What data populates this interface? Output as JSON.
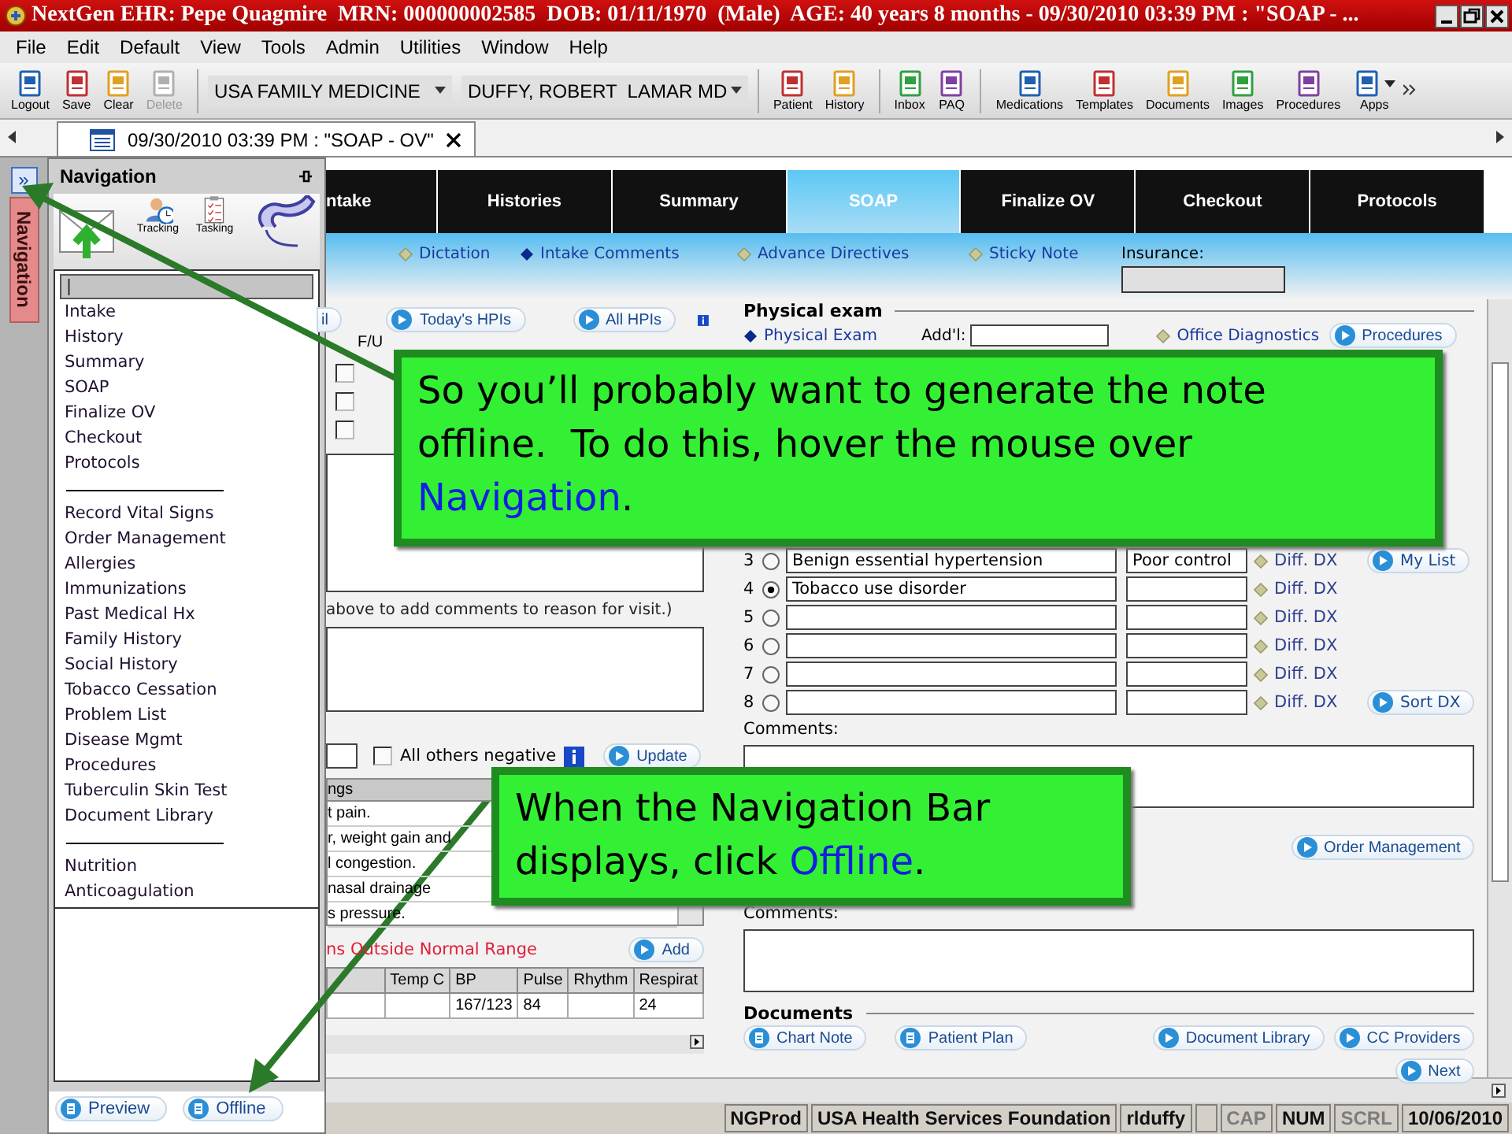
{
  "title_bar": {
    "title": "NextGen EHR: Pepe Quagmire  MRN: 000000002585  DOB: 01/11/1970  (Male)  AGE: 40 years 8 months - 09/30/2010 03:39 PM : \"SOAP - ..."
  },
  "menu": [
    "File",
    "Edit",
    "Default",
    "View",
    "Tools",
    "Admin",
    "Utilities",
    "Window",
    "Help"
  ],
  "toolbar": {
    "left": [
      {
        "label": "Logout",
        "disabled": false
      },
      {
        "label": "Save",
        "disabled": false
      },
      {
        "label": "Clear",
        "disabled": false
      },
      {
        "label": "Delete",
        "disabled": true
      }
    ],
    "combos": [
      "USA FAMILY MEDICINE",
      "DUFFY, ROBERT  LAMAR MD"
    ],
    "right": [
      {
        "label": "Patient",
        "dropdown": false
      },
      {
        "label": "History",
        "dropdown": false
      },
      {
        "label": "Inbox",
        "dropdown": false
      },
      {
        "label": "PAQ",
        "dropdown": false
      },
      {
        "label": "Medications",
        "dropdown": false
      },
      {
        "label": "Templates",
        "dropdown": false
      },
      {
        "label": "Documents",
        "dropdown": false
      },
      {
        "label": "Images",
        "dropdown": false
      },
      {
        "label": "Procedures",
        "dropdown": false
      },
      {
        "label": "Apps",
        "dropdown": true
      }
    ]
  },
  "document_tab": {
    "label": "09/30/2010 03:39 PM : \"SOAP - OV\"",
    "selected": true
  },
  "nav_strip": {
    "expand": "»",
    "label": "Navigation"
  },
  "nav_panel": {
    "title": "Navigation",
    "shortcuts": [
      {
        "kind": "mail"
      },
      {
        "kind": "tracking",
        "label": "Tracking"
      },
      {
        "kind": "tasking",
        "label": "Tasking"
      },
      {
        "kind": "phone"
      }
    ],
    "groups": [
      [
        {
          "label": "|",
          "selected": true
        },
        {
          "label": "Intake",
          "selected": false
        },
        {
          "label": "History",
          "selected": false
        },
        {
          "label": "Summary",
          "selected": false
        },
        {
          "label": "SOAP",
          "selected": false
        },
        {
          "label": "Finalize OV",
          "selected": false
        },
        {
          "label": "Checkout",
          "selected": false
        },
        {
          "label": "Protocols",
          "selected": false
        }
      ],
      [
        {
          "label": "Record Vital Signs",
          "selected": false
        },
        {
          "label": "Order Management",
          "selected": false
        },
        {
          "label": "Allergies",
          "selected": false
        },
        {
          "label": "Immunizations",
          "selected": false
        },
        {
          "label": "Past Medical Hx",
          "selected": false
        },
        {
          "label": "Family History",
          "selected": false
        },
        {
          "label": "Social History",
          "selected": false
        },
        {
          "label": "Tobacco Cessation",
          "selected": false
        },
        {
          "label": "Problem List",
          "selected": false
        },
        {
          "label": "Disease Mgmt",
          "selected": false
        },
        {
          "label": "Procedures",
          "selected": false
        },
        {
          "label": "Tuberculin Skin Test",
          "selected": false
        },
        {
          "label": "Document Library",
          "selected": false
        }
      ],
      [
        {
          "label": "Nutrition",
          "selected": false
        },
        {
          "label": "Anticoagulation",
          "selected": false
        }
      ]
    ],
    "buttons": [
      {
        "label": "Preview",
        "kind": "doc"
      },
      {
        "label": "Offline",
        "kind": "doc"
      }
    ]
  },
  "tabs": [
    {
      "label": "ntake",
      "selected": false
    },
    {
      "label": "Histories",
      "selected": false
    },
    {
      "label": "Summary",
      "selected": false
    },
    {
      "label": "SOAP",
      "selected": true
    },
    {
      "label": "Finalize OV",
      "selected": false
    },
    {
      "label": "Checkout",
      "selected": false
    },
    {
      "label": "Protocols",
      "selected": false
    }
  ],
  "links": [
    {
      "label": "Dictation",
      "filled": false
    },
    {
      "label": "Intake Comments",
      "filled": true
    },
    {
      "label": "Advance Directives",
      "filled": false
    },
    {
      "label": "Sticky Note",
      "filled": false
    }
  ],
  "insurance": {
    "label": "Insurance:"
  },
  "hpi": {
    "buttons": [
      {
        "label": "il",
        "kind": "none"
      },
      {
        "label": "Today's HPIs",
        "kind": "play"
      },
      {
        "label": "All HPIs",
        "kind": "play"
      }
    ],
    "fu_label": "F/U",
    "rows": [
      {
        "checked": false
      },
      {
        "checked": false
      },
      {
        "checked": false
      }
    ]
  },
  "reason_hint": "above to add comments to reason for visit.)",
  "ros": {
    "checkbox_label": "All others negative",
    "checked": false,
    "button": "Update",
    "header": "ngs",
    "rows": [
      "t pain.",
      "r, weight gain and",
      "l congestion.",
      "nasal drainage",
      "s pressure."
    ]
  },
  "vitals": {
    "title": "ns Outside Normal Range",
    "button": "Add",
    "columns": [
      "Temp C",
      "BP",
      "Pulse",
      "Rhythm",
      "Respirat"
    ],
    "rows": [
      [
        null,
        "167/123",
        "84",
        null,
        "24"
      ]
    ]
  },
  "physical_exam": {
    "title": "Physical exam",
    "link": {
      "label": "Physical Exam",
      "filled": true
    },
    "addl_label": "Add'l:",
    "diagnostics": {
      "label": "Office Diagnostics",
      "filled": false
    },
    "button": "Procedures"
  },
  "assessment": {
    "rows": [
      {
        "number": "3",
        "selected": false,
        "diagnosis": "Benign essential hypertension",
        "status": "Poor control",
        "link": "Diff. DX",
        "button": "My List"
      },
      {
        "number": "4",
        "selected": true,
        "diagnosis": "Tobacco use disorder",
        "link": "Diff. DX"
      },
      {
        "number": "5",
        "selected": false,
        "link": "Diff. DX"
      },
      {
        "number": "6",
        "selected": false,
        "link": "Diff. DX"
      },
      {
        "number": "7",
        "selected": false,
        "link": "Diff. DX"
      },
      {
        "number": "8",
        "selected": false,
        "link": "Diff. DX",
        "button": "Sort DX"
      }
    ],
    "comments_label": "Comments:"
  },
  "plan": {
    "button": "Order Management",
    "comments_label": "Comments:"
  },
  "documents": {
    "title": "Documents",
    "buttons": [
      {
        "label": "Chart Note",
        "kind": "doc"
      },
      {
        "label": "Patient Plan",
        "kind": "doc"
      },
      {
        "label": "Document Library",
        "kind": "play"
      },
      {
        "label": "CC Providers",
        "kind": "play"
      },
      {
        "label": "Next",
        "kind": "play"
      }
    ]
  },
  "status_bar": [
    {
      "label": "NGProd",
      "disabled": false
    },
    {
      "label": "USA Health Services Foundation",
      "disabled": false
    },
    {
      "label": "rlduffy",
      "disabled": false
    },
    {
      "label": "CAP",
      "disabled": true
    },
    {
      "label": "NUM",
      "disabled": false
    },
    {
      "label": "SCRL",
      "disabled": true
    },
    {
      "label": "10/06/2010",
      "disabled": false
    }
  ],
  "callouts": [
    {
      "parts": [
        {
          "text": "So you’ll probably want to generate the note offline.  To do this, hover the mouse over ",
          "highlight": false
        },
        {
          "text": "Navigation",
          "highlight": true
        },
        {
          "text": ".",
          "highlight": false
        }
      ]
    },
    {
      "parts": [
        {
          "text": "When the Navigation Bar displays, click ",
          "highlight": false
        },
        {
          "text": "Offline",
          "highlight": true
        },
        {
          "text": ".",
          "highlight": false
        }
      ]
    }
  ]
}
